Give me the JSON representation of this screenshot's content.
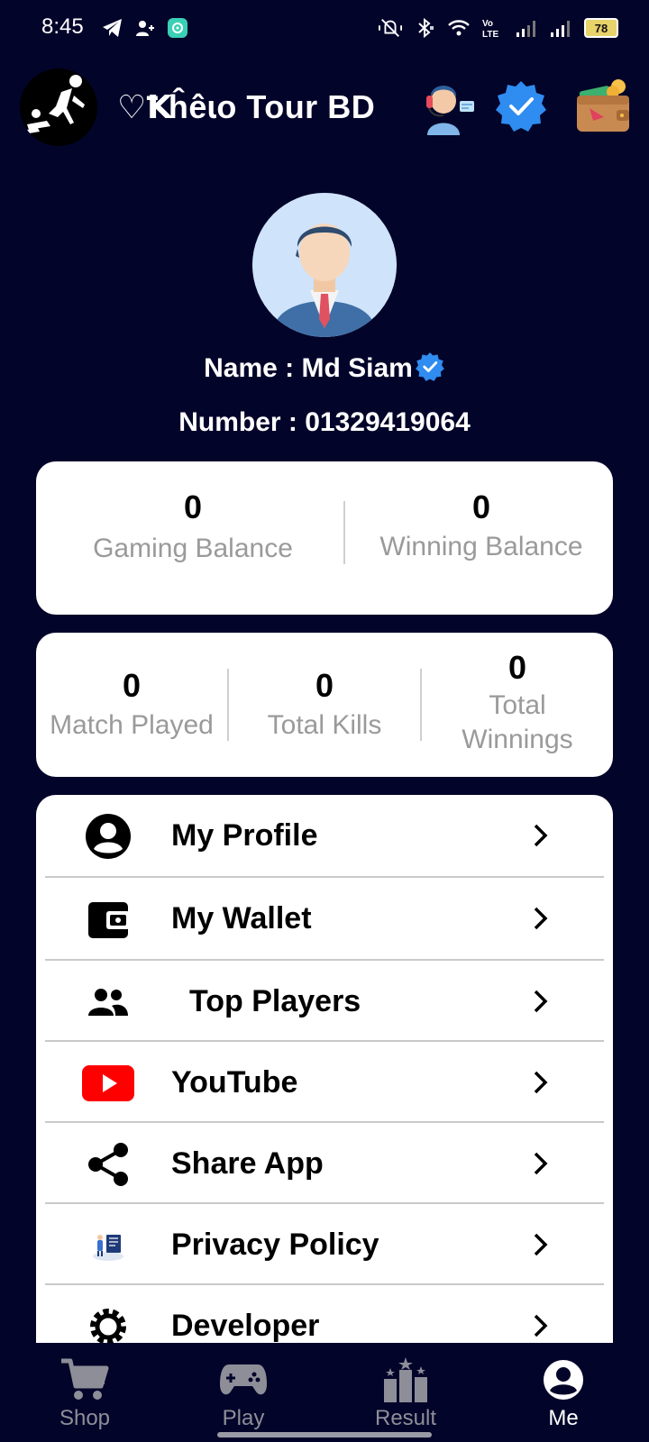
{
  "status_bar": {
    "time": "8:45",
    "battery": "78"
  },
  "header": {
    "title": "♡Ꝁĥêɩo Tour BD",
    "icons": [
      "logo-icon",
      "support-agent-icon",
      "verified-badge-icon",
      "wallet-icon"
    ]
  },
  "profile": {
    "name_label": "Name : Md Siam",
    "number_label": "Number : 01329419064"
  },
  "balances": [
    {
      "value": "0",
      "label": "Gaming Balance"
    },
    {
      "value": "0",
      "label": "Winning Balance"
    }
  ],
  "stats": [
    {
      "value": "0",
      "label": "Match Played"
    },
    {
      "value": "0",
      "label": "Total Kills"
    },
    {
      "value": "0",
      "label": "Total\nWinnings"
    }
  ],
  "menu": [
    {
      "label": "My Profile",
      "icon": "account-circle-icon"
    },
    {
      "label": "My Wallet",
      "icon": "wallet-icon"
    },
    {
      "label": "Top Players",
      "icon": "people-icon"
    },
    {
      "label": "YouTube",
      "icon": "youtube-icon"
    },
    {
      "label": "Share App",
      "icon": "share-icon"
    },
    {
      "label": "Privacy Policy",
      "icon": "privacy-policy-icon"
    },
    {
      "label": "Developer",
      "icon": "gear-icon"
    }
  ],
  "bottom_nav": [
    {
      "label": "Shop",
      "icon": "cart-icon",
      "active": false
    },
    {
      "label": "Play",
      "icon": "gamepad-icon",
      "active": false
    },
    {
      "label": "Result",
      "icon": "podium-icon",
      "active": false
    },
    {
      "label": "Me",
      "icon": "account-circle-icon",
      "active": true
    }
  ],
  "colors": {
    "background": "#03042a",
    "card": "#ffffff",
    "verified_blue": "#2f8cf0",
    "muted_label": "#9a9a9a",
    "youtube_red": "#ff0000"
  }
}
